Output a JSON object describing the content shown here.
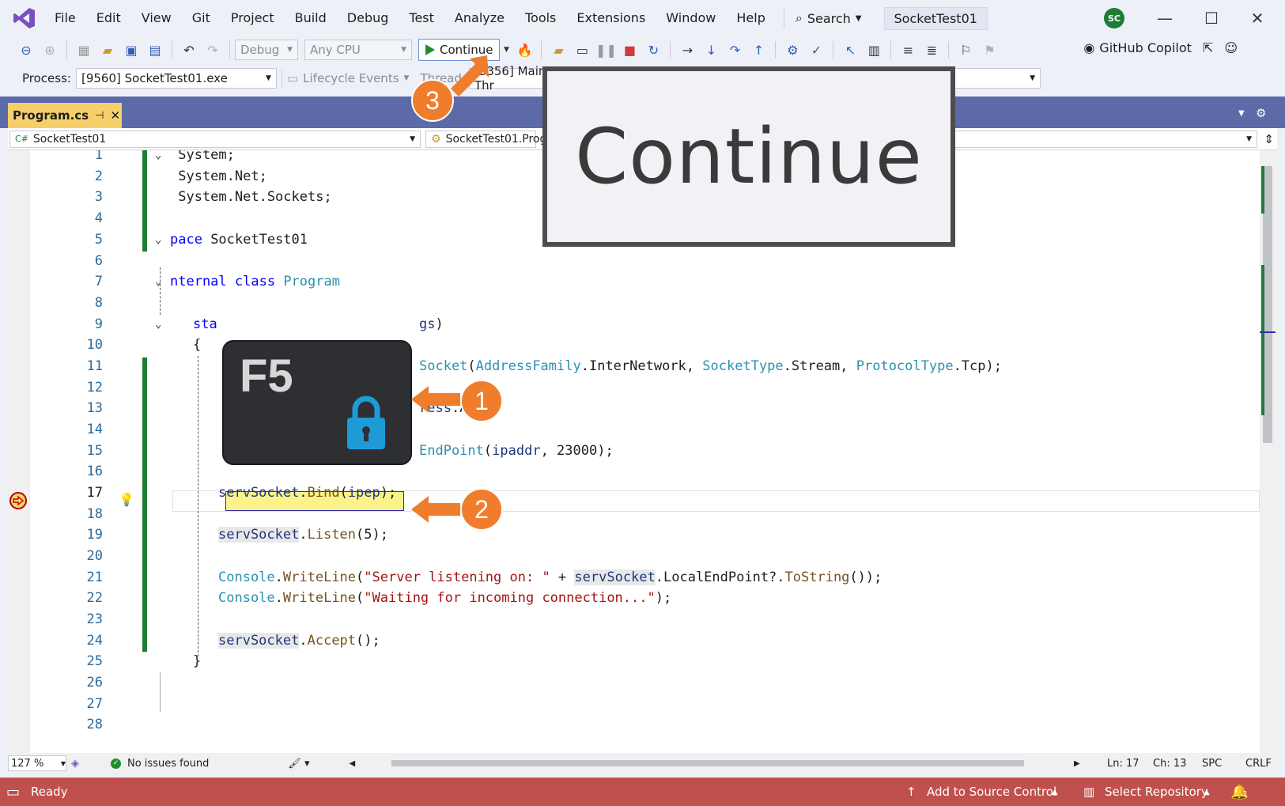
{
  "menu": {
    "items": [
      "File",
      "Edit",
      "View",
      "Git",
      "Project",
      "Build",
      "Debug",
      "Test",
      "Analyze",
      "Tools",
      "Extensions",
      "Window",
      "Help"
    ],
    "search_label": "Search",
    "solution_name": "SocketTest01",
    "user_initials": "SC"
  },
  "toolbar": {
    "config": "Debug",
    "platform": "Any CPU",
    "continue_label": "Continue",
    "copilot_label": "GitHub Copilot"
  },
  "debug_toolbar": {
    "process_label": "Process:",
    "process_value": "[9560] SocketTest01.exe",
    "lifecycle_label": "Lifecycle Events",
    "thread_label": "Thread:",
    "thread_value": "[3356] Main Thr"
  },
  "document": {
    "tab_name": "Program.cs",
    "nav_project": "SocketTest01",
    "nav_type": "SocketTest01.Prog",
    "nav_member_tail": "s)"
  },
  "code": {
    "lines": [
      "1",
      "2",
      "3",
      "4",
      "5",
      "6",
      "7",
      "8",
      "9",
      "10",
      "11",
      "12",
      "13",
      "14",
      "15",
      "16",
      "17",
      "18",
      "19",
      "20",
      "21",
      "22",
      "23",
      "24",
      "25",
      "26",
      "27",
      "28"
    ],
    "current_line": "17"
  },
  "annotations": {
    "zoom_text": "Continue",
    "key_label": "F5",
    "badges": [
      "1",
      "2",
      "3"
    ]
  },
  "editor_status": {
    "zoom": "127 %",
    "issues": "No issues found",
    "line": "Ln: 17",
    "col": "Ch: 13",
    "spacing": "SPC",
    "eol": "CRLF"
  },
  "statusbar": {
    "state": "Ready",
    "source_control": "Add to Source Control",
    "repository": "Select Repository",
    "notifications": "1"
  },
  "colors": {
    "status_bar": "#c0504d",
    "accent_orange": "#ef7d2c",
    "doc_strip": "#5c6ba8",
    "active_tab": "#f5cf6a"
  }
}
